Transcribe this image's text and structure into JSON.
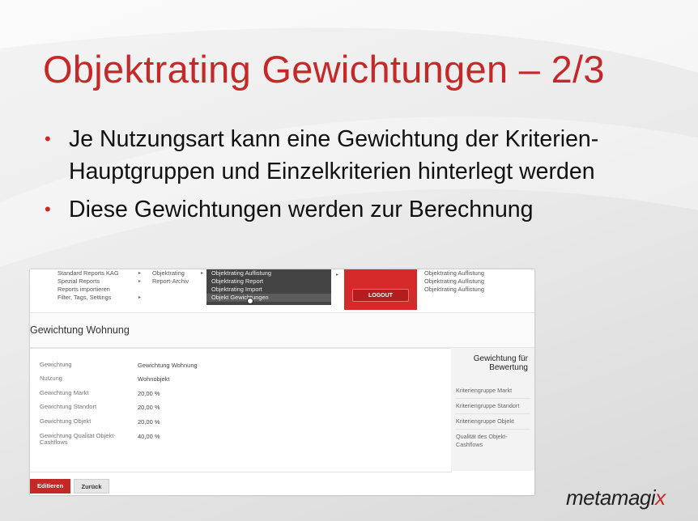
{
  "slide": {
    "title": "Objektrating Gewichtungen – 2/3",
    "bullets": [
      "Je Nutzungsart kann eine Gewichtung der Kriterien-Hauptgruppen und Einzelkriterien hinterlegt werden",
      "Diese Gewichtungen werden zur Berechnung"
    ],
    "logo_main": "metamagi",
    "logo_x": "x"
  },
  "app": {
    "menu_col1": [
      "Standard Reports KAG",
      "Spezial Reports",
      "Reports importieren",
      "Filter, Tags, Settings"
    ],
    "menu_col2": [
      "Objektrating",
      "Report-Archiv"
    ],
    "submenu": [
      "Objektrating Auflistung",
      "Objektrating Report",
      "Objektrating Import",
      "Objekt Gewichtungen"
    ],
    "logout": "LOGOUT",
    "right_links": [
      "Objektrating Auflistung",
      "Objektrating Auflistung",
      "Objektrating Auflistung"
    ],
    "page_title": "Gewichtung Wohnung",
    "fields": [
      {
        "label": "Gewichtung",
        "value": "Gewichtung Wohnung"
      },
      {
        "label": "Nutzung",
        "value": "Wohnobjekt"
      },
      {
        "label": "Gewichtung Markt",
        "value": "20,00 %"
      },
      {
        "label": "Gewichtung Standort",
        "value": "20,00 %"
      },
      {
        "label": "Gewichtung Objekt",
        "value": "20,00 %"
      },
      {
        "label": "Gewichtung Qualität Objekt-Cashflows",
        "value": "40,00 %"
      }
    ],
    "side_title": "Gewichtung für Bewertung",
    "side_items": [
      "Kriteriengruppe Markt",
      "Kriteriengruppe Standort",
      "Kriteriengruppe Objekt",
      "Qualität des Objekt-Cashflows"
    ],
    "edit_button": "Editieren",
    "back_button": "Zurück"
  }
}
